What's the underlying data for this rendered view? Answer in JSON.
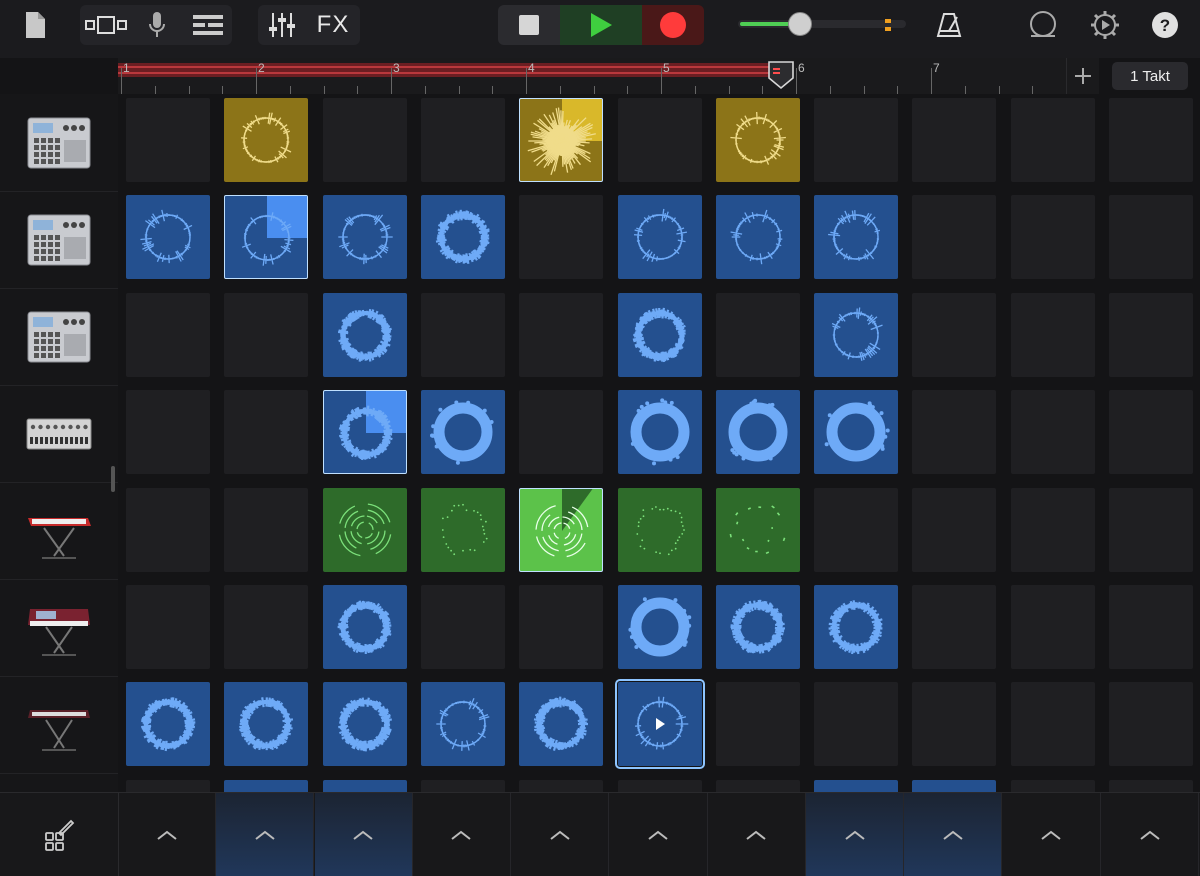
{
  "toolbar": {
    "fx_label": "FX",
    "icons": [
      "document-icon",
      "view-toggle-icon",
      "microphone-icon",
      "tracks-view-icon",
      "mixer-icon",
      "stop-icon",
      "play-icon",
      "record-icon",
      "metronome-icon",
      "loop-icon",
      "settings-icon",
      "help-icon"
    ],
    "master_volume": 0.37
  },
  "ruler": {
    "bars": [
      "1",
      "2",
      "3",
      "4",
      "5",
      "6",
      "7"
    ],
    "loop_end_bar": 6,
    "playhead_bar": 6
  },
  "section_length_label": "1 Takt",
  "tracks": [
    {
      "instrument": "drum-machine-icon"
    },
    {
      "instrument": "drum-machine-icon"
    },
    {
      "instrument": "drum-machine-icon"
    },
    {
      "instrument": "bass-synth-icon"
    },
    {
      "instrument": "red-keyboard-icon"
    },
    {
      "instrument": "synth-keyboard-icon"
    },
    {
      "instrument": "keyboard-stand-icon"
    },
    {
      "instrument": "drum-machine-icon"
    }
  ],
  "cells": [
    {
      "row": 0,
      "col": 1,
      "type": "yellow",
      "wave": "ring-thin"
    },
    {
      "row": 0,
      "col": 4,
      "type": "yellow",
      "wave": "burst",
      "progress": 0.25
    },
    {
      "row": 0,
      "col": 6,
      "type": "yellow",
      "wave": "ring-thin"
    },
    {
      "row": 1,
      "col": 0,
      "type": "blue",
      "wave": "ring-spiky"
    },
    {
      "row": 1,
      "col": 1,
      "type": "blue",
      "wave": "ring-spiky",
      "progress": 0.25
    },
    {
      "row": 1,
      "col": 2,
      "type": "blue",
      "wave": "ring-spiky"
    },
    {
      "row": 1,
      "col": 3,
      "type": "blue",
      "wave": "ring-dense"
    },
    {
      "row": 1,
      "col": 5,
      "type": "blue",
      "wave": "ring-spiky"
    },
    {
      "row": 1,
      "col": 6,
      "type": "blue",
      "wave": "ring-spiky"
    },
    {
      "row": 1,
      "col": 7,
      "type": "blue",
      "wave": "ring-spiky"
    },
    {
      "row": 2,
      "col": 2,
      "type": "blue",
      "wave": "ring-dense"
    },
    {
      "row": 2,
      "col": 5,
      "type": "blue",
      "wave": "ring-dense"
    },
    {
      "row": 2,
      "col": 7,
      "type": "blue",
      "wave": "ring-spiky"
    },
    {
      "row": 3,
      "col": 2,
      "type": "blue",
      "wave": "ring-dense",
      "progress": 0.25
    },
    {
      "row": 3,
      "col": 3,
      "type": "blue",
      "wave": "ring-solid"
    },
    {
      "row": 3,
      "col": 5,
      "type": "blue",
      "wave": "ring-solid"
    },
    {
      "row": 3,
      "col": 6,
      "type": "blue",
      "wave": "ring-solid"
    },
    {
      "row": 3,
      "col": 7,
      "type": "blue",
      "wave": "ring-solid"
    },
    {
      "row": 4,
      "col": 2,
      "type": "green",
      "wave": "arcs"
    },
    {
      "row": 4,
      "col": 3,
      "type": "green",
      "wave": "dots"
    },
    {
      "row": 4,
      "col": 4,
      "type": "green-bright",
      "wave": "arcs",
      "progress": 0.1
    },
    {
      "row": 4,
      "col": 5,
      "type": "green",
      "wave": "dots"
    },
    {
      "row": 4,
      "col": 6,
      "type": "green",
      "wave": "dashes"
    },
    {
      "row": 5,
      "col": 2,
      "type": "blue",
      "wave": "ring-dense"
    },
    {
      "row": 5,
      "col": 5,
      "type": "blue",
      "wave": "ring-solid"
    },
    {
      "row": 5,
      "col": 6,
      "type": "blue",
      "wave": "ring-dense"
    },
    {
      "row": 5,
      "col": 7,
      "type": "blue",
      "wave": "ring-dense"
    },
    {
      "row": 6,
      "col": 0,
      "type": "blue",
      "wave": "ring-dense"
    },
    {
      "row": 6,
      "col": 1,
      "type": "blue",
      "wave": "ring-dense"
    },
    {
      "row": 6,
      "col": 2,
      "type": "blue",
      "wave": "ring-dense"
    },
    {
      "row": 6,
      "col": 3,
      "type": "blue",
      "wave": "ring-spiky"
    },
    {
      "row": 6,
      "col": 4,
      "type": "blue",
      "wave": "ring-dense"
    },
    {
      "row": 6,
      "col": 5,
      "type": "blue",
      "wave": "ring-spiky",
      "selected": true
    },
    {
      "row": 7,
      "col": 1,
      "type": "blue",
      "wave": "ring-spiky"
    },
    {
      "row": 7,
      "col": 2,
      "type": "blue",
      "wave": "ring-spiky"
    },
    {
      "row": 7,
      "col": 7,
      "type": "blue",
      "wave": "ring-spiky"
    },
    {
      "row": 7,
      "col": 8,
      "type": "blue",
      "wave": "ring-spiky"
    }
  ],
  "grid": {
    "columns": 11,
    "visible_rows": 8
  },
  "trigger_columns_active": [
    1,
    2,
    7,
    8
  ],
  "bottom": {
    "edit_icon": "edit-cells-icon",
    "trigger_icon": "chevron-up-icon"
  },
  "colors": {
    "yellow": "#8c7418",
    "blue": "#24508f",
    "green": "#2e6b2a",
    "play": "#3fce3f",
    "record": "#ff3b3b"
  }
}
